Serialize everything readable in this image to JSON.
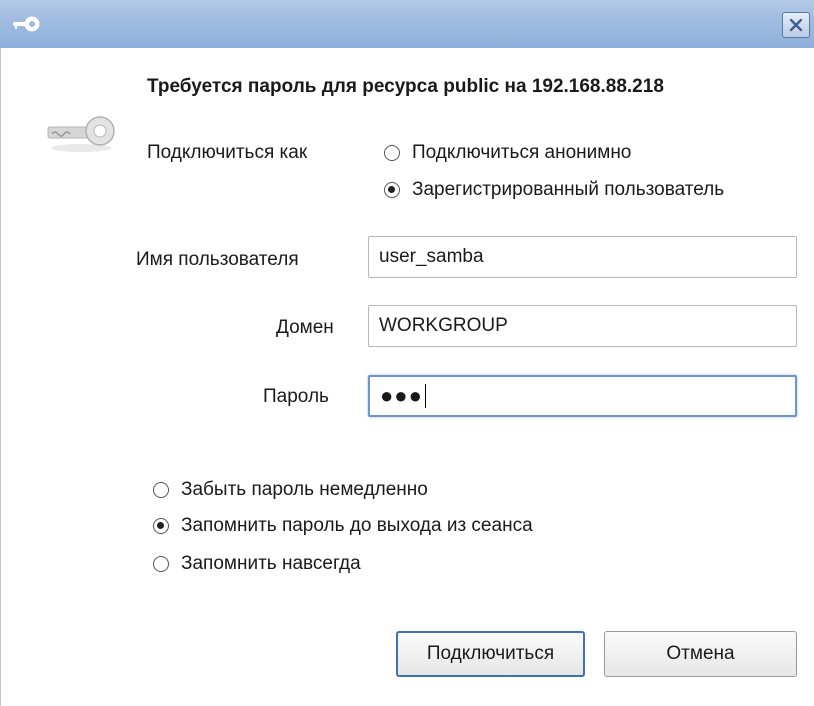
{
  "window": {
    "title_icon": "key-icon",
    "close_icon": "close-icon"
  },
  "dialog": {
    "icon": "key-icon",
    "heading": "Требуется пароль для ресурса public на 192.168.88.218",
    "connect_as_label": "Подключиться как",
    "connect_options": [
      {
        "label": "Подключиться анонимно",
        "selected": false
      },
      {
        "label": "Зарегистрированный пользователь",
        "selected": true
      }
    ],
    "username": {
      "label": "Имя пользователя",
      "value": "user_samba"
    },
    "domain": {
      "label": "Домен",
      "value": "WORKGROUP"
    },
    "password": {
      "label": "Пароль",
      "masked": "●●●"
    },
    "remember_options": [
      {
        "label": "Забыть пароль немедленно",
        "selected": false
      },
      {
        "label": "Запомнить пароль до выхода из сеанса",
        "selected": true
      },
      {
        "label": "Запомнить навсегда",
        "selected": false
      }
    ],
    "connect_button": "Подключиться",
    "cancel_button": "Отмена"
  },
  "colors": {
    "titlebar": "#9fbbe0",
    "focus_border": "#6d95cf",
    "default_button_border": "#3f6fb5"
  }
}
